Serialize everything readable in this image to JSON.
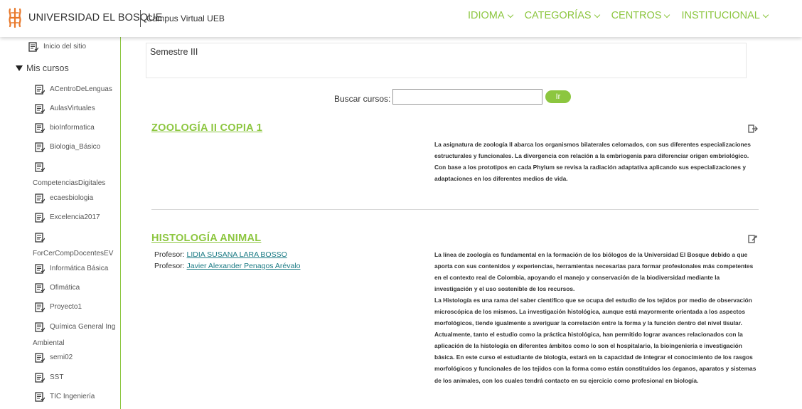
{
  "header": {
    "brand": "UNIVERSIDAD EL BOSQUE",
    "campus": "Campus Virtual UEB",
    "nav": [
      {
        "label": "IDIOMA"
      },
      {
        "label": "CATEGORÍAS"
      },
      {
        "label": "CENTROS"
      },
      {
        "label": "INSTITUCIONAL"
      }
    ]
  },
  "sidebar": {
    "home": "Inicio del sitio",
    "my_courses": "Mis cursos",
    "courses": [
      "ACentroDeLenguas",
      "AulasVirtuales",
      "bioInformatica",
      "Biologia_Básico",
      "CompetenciasDigitales",
      "ecaesbiologia",
      "Excelencia2017",
      "ForCerCompDocentesEV",
      "Informática Básica",
      "Ofimática",
      "Proyecto1",
      "Química General Ing",
      "Ambiental",
      "semi02",
      "SST",
      "TIC Ingeniería"
    ]
  },
  "main": {
    "semester": "Semestre III",
    "search": {
      "label": "Buscar cursos:",
      "value": "",
      "button": "Ir"
    },
    "courses": [
      {
        "title": "ZOOLOGÍA II COPIA 1",
        "summary": "La asignatura de zoología II abarca los organismos bilaterales celomados, con sus diferentes especializaciones estructurales y funcionales. La divergencia  con relación a la embriogenia para diferenciar origen embriológico. Con base a los prototipos en cada Phylum se revisa la radiación adaptativa aplicando sus especializaciones y adaptaciones en los diferentes medios de vida.",
        "icon": "enrol-arrow-icon"
      },
      {
        "title": "HISTOLOGÍA ANIMAL",
        "teacher_label": "Profesor:",
        "teachers": [
          "LIDIA SUSANA LARA BOSSO",
          "Javier Alexander Penagos Arévalo"
        ],
        "summary": "La línea de zoología es fundamental en la formación de los biólogos de la Universidad El Bosque debido a que aporta con sus contenidos y experiencias, herramientas necesarias para formar profesionales más competentes en el contexto real de Colombia, apoyando el manejo y conservación de la biodiversidad mediante la investigación y el uso sostenible de los recursos.",
        "summary2": "La Histología es una rama del saber científico que se ocupa del estudio de los tejidos por medio de observación microscópica de los mismos. La investigación histológica, aunque está mayormente orientada a los aspectos morfológicos, tiende igualmente a averiguar la correlación entre la forma y la función dentro del nivel tisular. Actualmente, tanto el estudio como la práctica histológica, han permitido lograr avances relacionados con la aplicación de la histología en diferentes ámbitos como lo son el hospitalario, la bioingeniería e investigación básica. En este curso el estudiante de biología, estará en la capacidad de integrar el conocimiento de los rasgos morfológicos y funcionales de los tejidos con la forma como están constituidos los órganos, aparatos y sistemas de los animales, con los cuales tendrá contacto en su ejercicio como profesional en biología.",
        "icon": "enrol-key-icon"
      }
    ]
  },
  "colors": {
    "accent": "#8cc63f",
    "link": "#1a7a84",
    "logo": "#e8782a"
  }
}
